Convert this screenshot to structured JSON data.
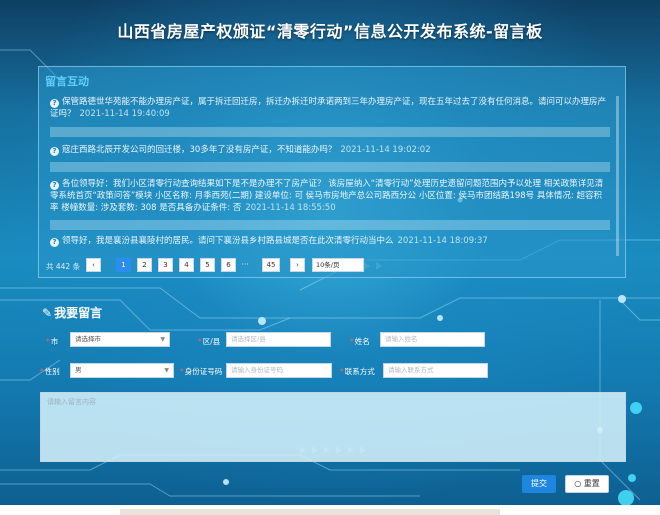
{
  "page": {
    "title": "山西省房屋产权颁证“清零行动”信息公开发布系统-留言板"
  },
  "messages_panel": {
    "title": "留言互动",
    "items": [
      {
        "icon": "question-icon",
        "text": "保管路德世华苑能不能办理房产证，属于拆迁回迁房，拆迁办拆迁时承诺两到三年办理房产证，现在五年过去了没有任何消息。请问可以办理房产证吗？",
        "time": "2021-11-14 19:40:09"
      },
      {
        "icon": "question-icon",
        "text": "寇庄西路北辰开发公司的回迁楼，30多年了没有房产证，不知道能办吗？",
        "time": "2021-11-14 19:02:02"
      },
      {
        "icon": "question-icon",
        "text": "各位领导好：我们小区清零行动查询结果如下是不是办理不了房产证？ 该房屋纳入“清零行动”处理历史遗留问题范围内予以处理 相关政策详见清零系统首页“政策问答”模块 小区名称: 月季西苑(二期) 建设单位: 可 侯马市房地产总公司路西分公 小区位置: 侯马市团结路198号 具体情况: 超容积率 楼幢数量: 涉及套数: 308 是否具备办证条件: 否",
        "time": "2021-11-14 18:55:50"
      },
      {
        "icon": "question-icon",
        "text": "领导好，我是襄汾县襄陵村的居民。请问下襄汾县乡村路县城是否在此次清零行动当中么",
        "time": "2021-11-14 18:09:37"
      }
    ]
  },
  "pagination": {
    "total": "共 442 条",
    "prev": "‹",
    "next": "›",
    "pages": [
      "1",
      "2",
      "3",
      "4",
      "5",
      "6"
    ],
    "ellipsis": "···",
    "last": "45",
    "page_size": "10条/页",
    "active_page": "1"
  },
  "form": {
    "title": "我要留言",
    "city_label": "市",
    "city_value": "请选择市",
    "district_label": "区/县",
    "district_placeholder": "请选择区/县",
    "name_label": "姓名",
    "name_placeholder": "请输入姓名",
    "gender_label": "性别",
    "gender_value": "男",
    "id_label": "身份证号码",
    "id_placeholder": "请输入身份证号码",
    "contact_label": "联系方式",
    "contact_placeholder": "请输入联系方式",
    "message_placeholder": "请输入留言内容",
    "submit_label": "提交",
    "reset_label": "重置"
  },
  "colors": {
    "accent": "#1f86e0",
    "panel_title": "#5fd0ff",
    "required": "#ff5a5a"
  }
}
